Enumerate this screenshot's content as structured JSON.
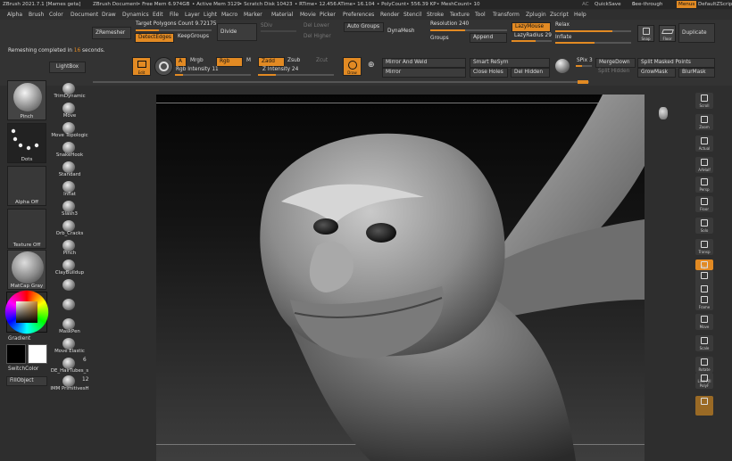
{
  "titlebar": {
    "app": "ZBrush 2021.7.1 [Mames geta]",
    "doc": "ZBrush Document",
    "free_mem": "• Free Mem 6.974GB",
    "active_mem": "• Active Mem 3129",
    "scratch": "• Scratch Disk 10423",
    "rtime": "• RTime• 12.456",
    "atime": "ATime• 16.104",
    "polycount": "• PolyCount• 556.39 KP",
    "meshcount": "• MeshCount• 10",
    "ac": "AC",
    "quicksave": "QuickSave",
    "seethrough": "See-through",
    "seethrough_val": "0",
    "menus": "Menus",
    "defaultscript": "DefaultZScript"
  },
  "menubar": [
    "Alpha",
    "Brush",
    "Color",
    "Document",
    "Draw",
    "Dynamics",
    "Edit",
    "File",
    "Layer",
    "Light",
    "Macro",
    "Marker",
    "Material",
    "Movie",
    "Picker",
    "Preferences",
    "Render",
    "Stencil",
    "Stroke",
    "Texture",
    "Tool",
    "Transform",
    "Zplugin",
    "Zscript",
    "Help"
  ],
  "toolbar1": {
    "zremesher": "ZRemesher",
    "target_label": "Target Polygons Count",
    "target_val": "9.72175",
    "detect": "DetectEdges",
    "keepgroups": "KeepGroups",
    "divide": "Divide",
    "sdiv": "SDiv",
    "del_lower": "Del Lower",
    "del_higher": "Del Higher",
    "autogroups": "Auto Groups",
    "dynamesh": "DynaMesh",
    "groups": "Groups",
    "resolution_label": "Resolution",
    "resolution_val": "240",
    "append": "Append",
    "lazymouse": "LazyMouse",
    "lazyradius_label": "LazyRadius",
    "lazyradius_val": "29",
    "relax": "Relax",
    "inflate": "Inflate",
    "snap": "Snap",
    "floor": "Floor",
    "duplicate": "Duplicate"
  },
  "status": {
    "text_before": "Remeshing completed in",
    "seconds": "16",
    "text_after": "seconds."
  },
  "toolbar2": {
    "edit": "Edit",
    "a": "A",
    "mrgb": "Mrgb",
    "rgb": "Rgb",
    "m": "M",
    "zadd": "Zadd",
    "zsub": "Zsub",
    "zcut": "Zcut",
    "rgb_int_label": "Rgb Intensity",
    "rgb_int_val": "11",
    "z_int_label": "Z Intensity",
    "z_int_val": "24",
    "draw": "Draw",
    "mirror_weld": "Mirror And Weld",
    "mirror": "Mirror",
    "smart_resym": "Smart ReSym",
    "close_holes": "Close Holes",
    "del_hidden": "Del Hidden",
    "spix_label": "SPix",
    "spix_val": "3",
    "mergedown": "MergeDown",
    "split_hidden": "Split Hidden",
    "split_masked": "Split Masked Points",
    "growmask": "GrowMask",
    "blurmask": "BlurMask"
  },
  "leftpanel": {
    "lightbox": "LightBox",
    "brush_pinch": "Pinch",
    "stroke_dots": "Dots",
    "alpha_off": "Alpha Off",
    "texture_off": "Texture Off",
    "matcap": "MatCap Gray",
    "gradient": "Gradient",
    "switchcolor": "SwitchColor",
    "fillobject": "FillObject"
  },
  "brushes": [
    "TrimDynamic",
    "Move",
    "Move Topologic",
    "SnakeHook",
    "Standard",
    "Inflat",
    "Slash3",
    "Orb_Cracks",
    "Pinch",
    "ClayBuildup",
    "",
    "",
    "MaskPen",
    "Move Elastic",
    "DE_HairTubes_s",
    "IMM PrimitivesH"
  ],
  "brush_counts": {
    "hairtubes": "6",
    "imm": "12"
  },
  "righttools": [
    "Scroll",
    "Zoom",
    "Actual",
    "AAHalf",
    "Persp",
    "Floor",
    "Solo",
    "Transp",
    "",
    "Xyz",
    "",
    "",
    "Frame",
    "Move",
    "Scale",
    "Rotate",
    "Line Fill PolyF",
    ""
  ],
  "colors": {
    "accent": "#e28a23",
    "bg": "#2b2b2b",
    "canvas_top": "#050505",
    "canvas_bottom": "#3e3e3e"
  }
}
